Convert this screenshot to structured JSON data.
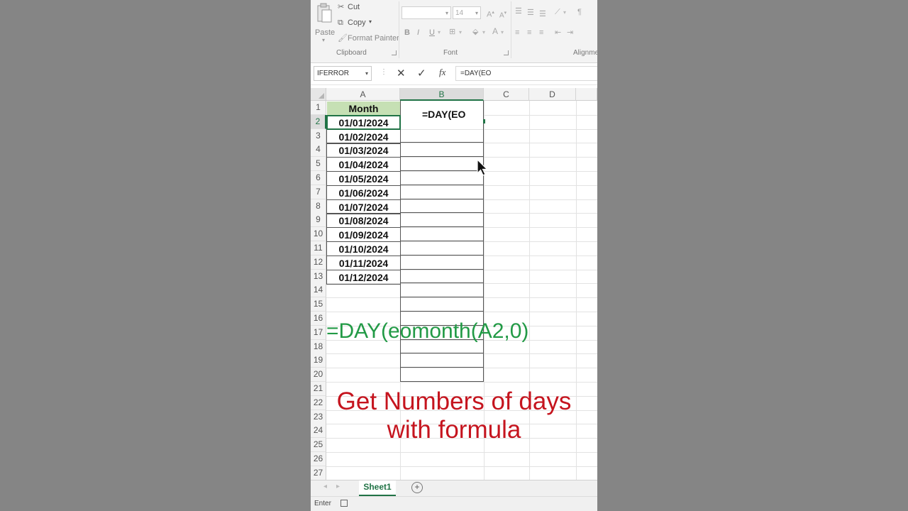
{
  "ribbon": {
    "clipboard": {
      "paste_label": "Paste",
      "cut_label": "Cut",
      "copy_label": "Copy",
      "format_painter_label": "Format Painter",
      "group_label": "Clipboard"
    },
    "font": {
      "font_name_value": "",
      "font_size_value": "14",
      "group_label": "Font",
      "bold_label": "B",
      "italic_label": "I",
      "underline_label": "U"
    },
    "alignment": {
      "group_label": "Alignmen"
    }
  },
  "formula_bar": {
    "name_box_value": "IFERROR",
    "cancel_icon": "x-icon",
    "enter_icon": "check-icon",
    "fx_label": "fx",
    "formula_value": "=DAY(EO"
  },
  "grid": {
    "columns": [
      "A",
      "B",
      "C",
      "D"
    ],
    "rows": [
      "1",
      "2",
      "3",
      "4",
      "5",
      "6",
      "7",
      "8",
      "9",
      "10",
      "11",
      "12",
      "13",
      "14",
      "15",
      "16",
      "17",
      "18",
      "19",
      "20",
      "21",
      "22",
      "23",
      "24",
      "25",
      "26",
      "27"
    ],
    "header_cell": "Month",
    "months": [
      "01/01/2024",
      "01/02/2024",
      "01/03/2024",
      "01/04/2024",
      "01/05/2024",
      "01/06/2024",
      "01/07/2024",
      "01/08/2024",
      "01/09/2024",
      "01/10/2024",
      "01/11/2024",
      "01/12/2024"
    ],
    "active_cell_value": "=DAY(EO",
    "active_cell_ref": "B2"
  },
  "sheet_tabs": {
    "active_tab": "Sheet1",
    "add_sheet_icon": "plus-circle-icon"
  },
  "status_bar": {
    "mode": "Enter"
  },
  "overlay": {
    "formula_caption": "=DAY(eomonth(A2,0)",
    "title_line1": "Get Numbers of days",
    "title_line2": "with formula"
  },
  "colors": {
    "excel_green": "#217346",
    "header_fill": "#c6e0b4",
    "caption_green": "#229a46",
    "caption_red": "#c5141e"
  }
}
